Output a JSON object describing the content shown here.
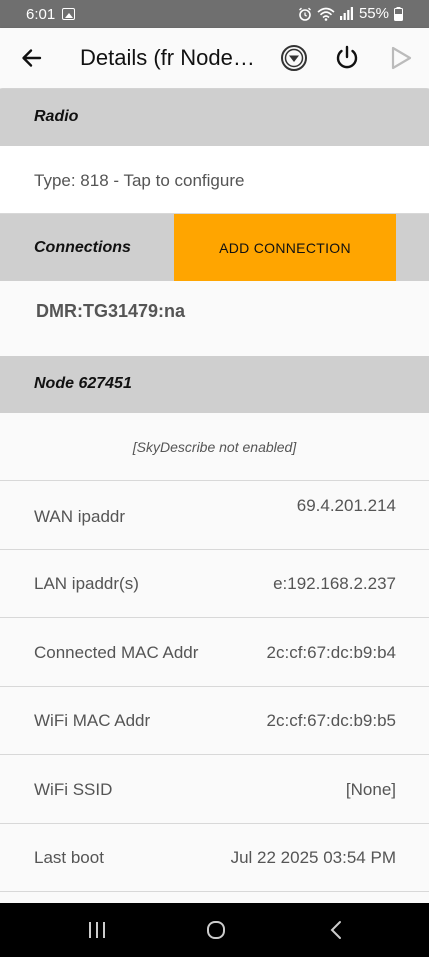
{
  "status_bar": {
    "time": "6:01",
    "battery": "55%",
    "icons": [
      "gallery-icon",
      "alarm-icon",
      "wifi-icon",
      "signal-icon",
      "battery-icon"
    ]
  },
  "app_bar": {
    "title": "Details (fr Node…",
    "icons": [
      "back-arrow-icon",
      "favorite-badge-icon",
      "power-icon",
      "play-icon"
    ]
  },
  "radio": {
    "header": "Radio",
    "type_text": "Type: 818 - Tap to configure"
  },
  "connections": {
    "header": "Connections",
    "add_button": "ADD CONNECTION",
    "items": [
      "DMR:TG31479:na"
    ]
  },
  "node": {
    "header": "Node 627451",
    "sky_describe": "[SkyDescribe not enabled]",
    "rows": [
      {
        "key": "WAN ipaddr",
        "value": "69.4.201.214"
      },
      {
        "key": "LAN ipaddr(s)",
        "value": "e:192.168.2.237"
      },
      {
        "key": "Connected MAC Addr",
        "value": "2c:cf:67:dc:b9:b4"
      },
      {
        "key": "WiFi MAC Addr",
        "value": "2c:cf:67:dc:b9:b5"
      },
      {
        "key": "WiFi SSID",
        "value": "[None]"
      },
      {
        "key": "Last boot",
        "value": "Jul 22 2025 03:54 PM"
      }
    ]
  },
  "colors": {
    "accent": "#ffa500",
    "section_header": "#cfcfcf",
    "status_bar": "#6f6f6f"
  }
}
